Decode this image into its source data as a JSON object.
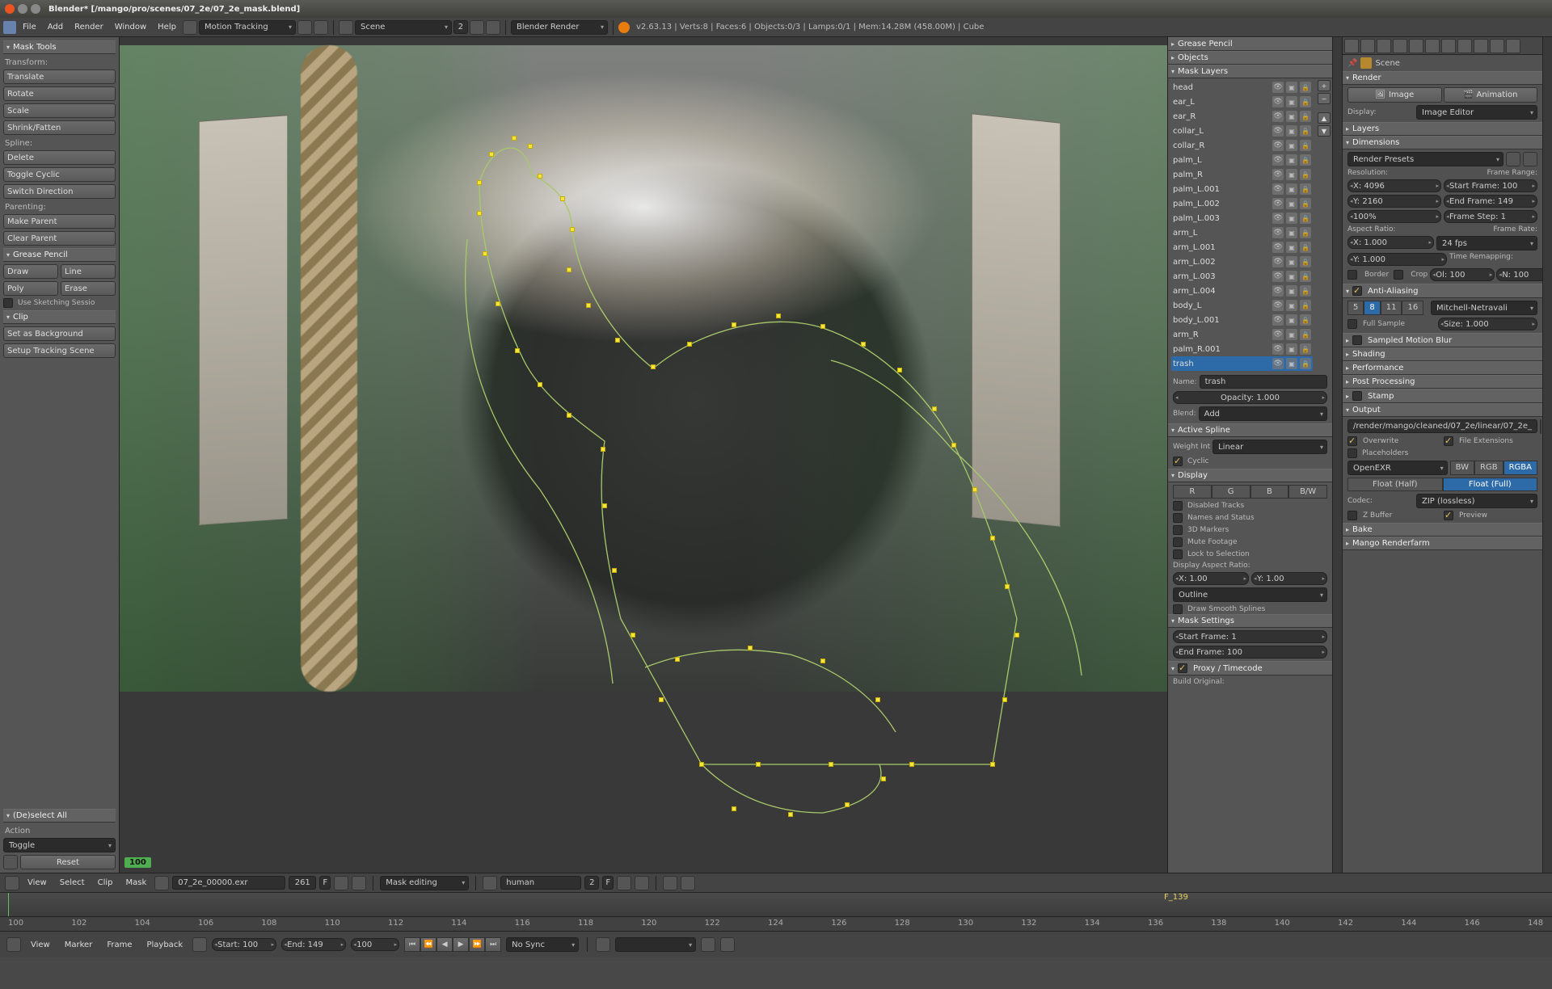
{
  "app": {
    "title": "Blender* [/mango/pro/scenes/07_2e/07_2e_mask.blend]",
    "stats": "v2.63.13 | Verts:8 | Faces:6 | Objects:0/3 | Lamps:0/1 | Mem:14.28M (458.00M) | Cube"
  },
  "top_menu": [
    "File",
    "Add",
    "Render",
    "Window",
    "Help"
  ],
  "layout_preset": "Motion Tracking",
  "scene_name": "Scene",
  "scene_num": "2",
  "render_engine": "Blender Render",
  "left": {
    "mask_tools": "Mask Tools",
    "transform": "Transform:",
    "translate": "Translate",
    "rotate": "Rotate",
    "scale": "Scale",
    "shrink": "Shrink/Fatten",
    "spline": "Spline:",
    "delete": "Delete",
    "toggle_cyclic": "Toggle Cyclic",
    "switch_dir": "Switch Direction",
    "parenting": "Parenting:",
    "make_parent": "Make Parent",
    "clear_parent": "Clear Parent",
    "grease": "Grease Pencil",
    "draw": "Draw",
    "line": "Line",
    "poly": "Poly",
    "erase": "Erase",
    "sketch": "Use Sketching Sessio",
    "clip": "Clip",
    "set_bg": "Set as Background",
    "setup_tracking": "Setup Tracking Scene",
    "deselect": "(De)select All",
    "action": "Action",
    "toggle": "Toggle",
    "reset": "Reset"
  },
  "clipbar": {
    "menu": [
      "View",
      "Select",
      "Clip",
      "Mask"
    ],
    "clip_name": "07_2e_00000.exr",
    "clip_len": "261",
    "mode": "Mask editing",
    "mask": "human",
    "mn": "2"
  },
  "timeline": {
    "marker": "F_139",
    "current": "100",
    "ticks": [
      100,
      102,
      104,
      106,
      108,
      110,
      112,
      114,
      116,
      118,
      120,
      122,
      124,
      126,
      128,
      130,
      132,
      134,
      136,
      138,
      140,
      142,
      144,
      146,
      148
    ]
  },
  "playback": {
    "menu": [
      "View",
      "Marker",
      "Frame",
      "Playback"
    ],
    "start": "Start: 100",
    "end": "End: 149",
    "cur": "100",
    "sync": "No Sync"
  },
  "right": {
    "grease": "Grease Pencil",
    "objects": "Objects",
    "mask_layers": "Mask Layers",
    "layers": [
      "head",
      "ear_L",
      "ear_R",
      "collar_L",
      "collar_R",
      "palm_L",
      "palm_R",
      "palm_L.001",
      "palm_L.002",
      "palm_L.003",
      "arm_L",
      "arm_L.001",
      "arm_L.002",
      "arm_L.003",
      "arm_L.004",
      "body_L",
      "body_L.001",
      "arm_R",
      "palm_R.001",
      "trash"
    ],
    "active_layer": "trash",
    "name_lbl": "Name:",
    "name_val": "trash",
    "opacity": "Opacity: 1.000",
    "blend_lbl": "Blend:",
    "blend_val": "Add",
    "active_spline": "Active Spline",
    "weight_lbl": "Weight Int",
    "weight_val": "Linear",
    "cyclic": "Cyclic",
    "display": "Display",
    "r": "R",
    "g": "G",
    "b": "B",
    "bw": "B/W",
    "disabled": "Disabled Tracks",
    "names": "Names and Status",
    "markers3d": "3D Markers",
    "mute": "Mute Footage",
    "locksel": "Lock to Selection",
    "dar": "Display Aspect Ratio:",
    "darx": "X: 1.00",
    "dary": "Y: 1.00",
    "outline": "Outline",
    "smooth": "Draw Smooth Splines",
    "mask_settings": "Mask Settings",
    "sf": "Start Frame: 1",
    "ef": "End Frame: 100",
    "proxy": "Proxy / Timecode",
    "build": "Build Original:"
  },
  "props": {
    "scene": "Scene",
    "render": "Render",
    "image": "Image",
    "animation": "Animation",
    "display_lbl": "Display:",
    "display_val": "Image Editor",
    "layers": "Layers",
    "dimensions": "Dimensions",
    "render_presets": "Render Presets",
    "resolution": "Resolution:",
    "frame_range": "Frame Range:",
    "resx": "X: 4096",
    "resy": "Y: 2160",
    "res_pct": "100%",
    "fr_start": "Start Frame: 100",
    "fr_end": "End Frame: 149",
    "fr_step": "Frame Step: 1",
    "aspect": "Aspect Ratio:",
    "ax": "X: 1.000",
    "ay": "Y: 1.000",
    "frate": "Frame Rate:",
    "fps": "24 fps",
    "time_remap": "Time Remapping:",
    "ol": "Ol: 100",
    "nu": "N: 100",
    "border": "Border",
    "crop": "Crop",
    "aa": "Anti-Aliasing",
    "aa_opts": [
      "5",
      "8",
      "11",
      "16"
    ],
    "aa_active": "8",
    "aa_filter": "Mitchell-Netravali",
    "full_sample": "Full Sample",
    "aa_size": "Size: 1.000",
    "smb": "Sampled Motion Blur",
    "shading": "Shading",
    "perf": "Performance",
    "post": "Post Processing",
    "stamp": "Stamp",
    "output": "Output",
    "outpath": "/render/mango/cleaned/07_2e/linear/07_2e_",
    "overwrite": "Overwrite",
    "file_ext": "File Extensions",
    "placeholders": "Placeholders",
    "format": "OpenEXR",
    "bw": "BW",
    "rgb": "RGB",
    "rgba": "RGBA",
    "half": "Float (Half)",
    "full": "Float (Full)",
    "codec_lbl": "Codec:",
    "codec": "ZIP (lossless)",
    "zbuf": "Z Buffer",
    "preview": "Preview",
    "bake": "Bake",
    "mango": "Mango Renderfarm"
  },
  "viewport": {
    "frame": "100"
  }
}
